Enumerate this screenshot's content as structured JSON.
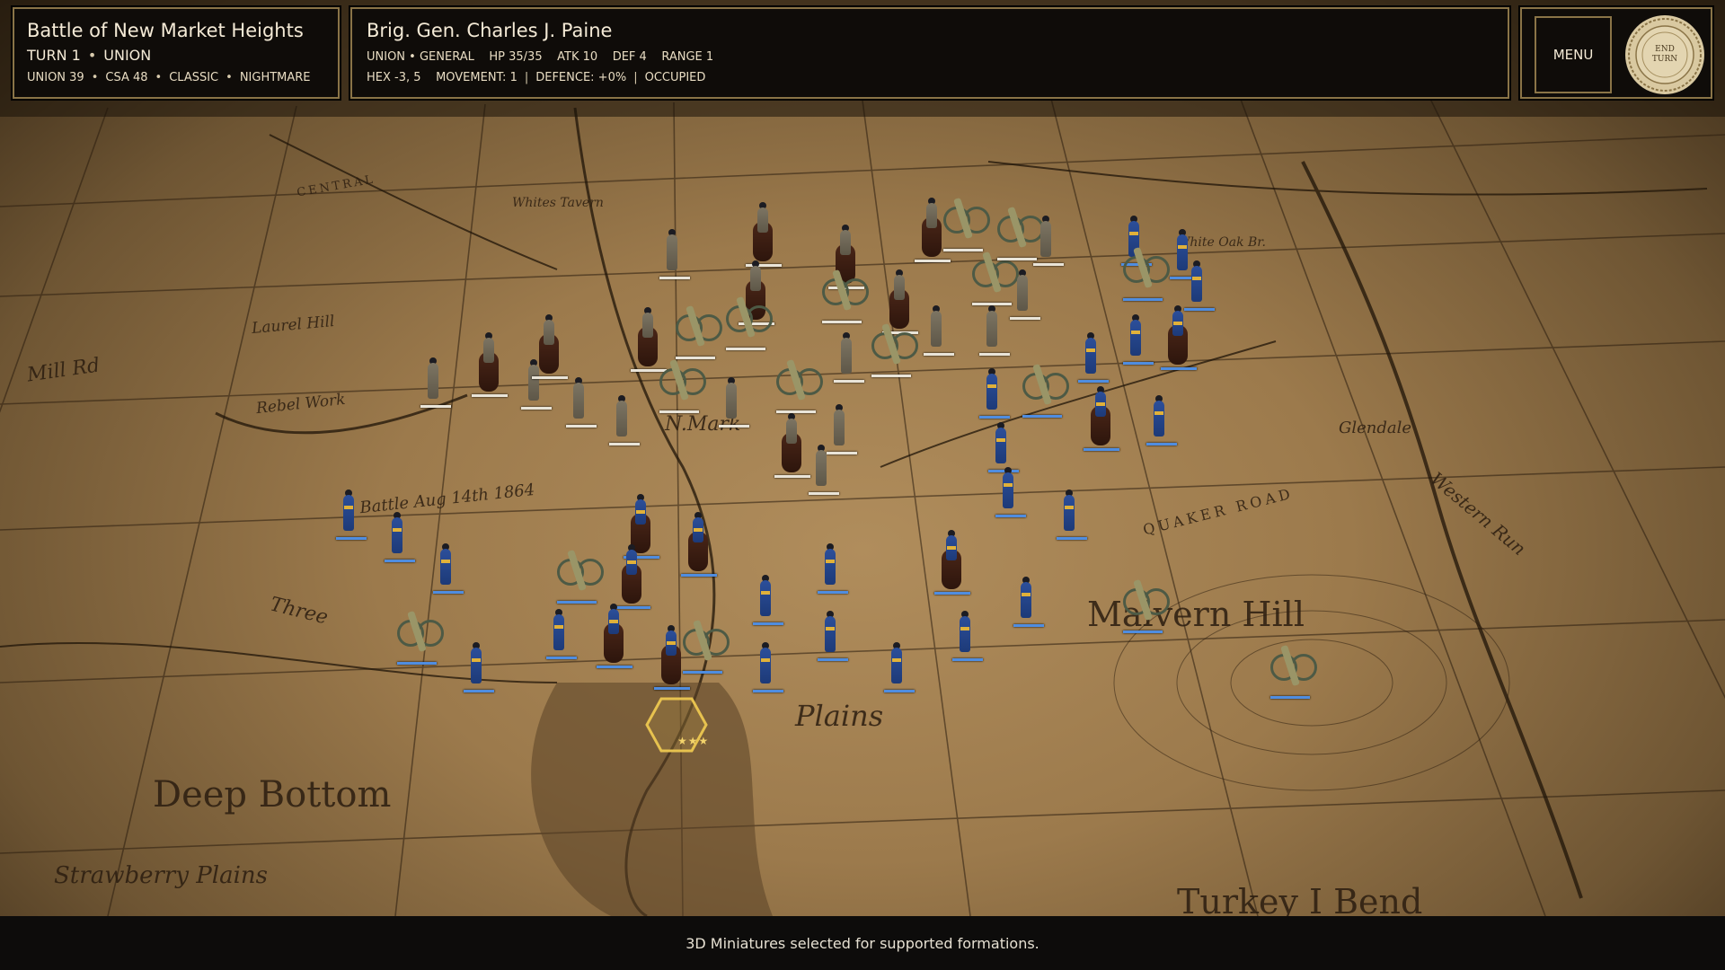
{
  "battle": {
    "title": "Battle of New Market Heights",
    "turn": "TURN 1",
    "side": "UNION",
    "union_score": "UNION 39",
    "csa_score": "CSA 48",
    "mode": "CLASSIC",
    "difficulty": "NIGHTMARE"
  },
  "selected_unit": {
    "name": "Brig. Gen. Charles J. Paine",
    "faction_role": "UNION • GENERAL",
    "hp": "HP 35/35",
    "atk": "ATK 10",
    "def": "DEF 4",
    "range": "RANGE 1",
    "hex": "HEX -3, 5",
    "movement": "MOVEMENT: 1",
    "defence": "DEFENCE: +0%",
    "occupied": "OCCUPIED",
    "rank_stars": "★★★"
  },
  "menu": {
    "menu_label": "MENU",
    "end_turn_label": "END\nTURN"
  },
  "status": {
    "message": "3D Miniatures selected for supported formations."
  },
  "map_labels": {
    "whites_tavern": "Whites Tavern",
    "laurel_hill": "Laurel Hill",
    "mill_rd": "Mill Rd",
    "rebel_work": "Rebel Work",
    "new_market": "N.Mark",
    "battle_note": "Battle Aug 14th 1864",
    "glendale": "Glendale",
    "plains": "Plains",
    "deep_bottom": "Deep Bottom",
    "strawberry_plains": "Strawberry Plains",
    "malvern_hill": "Malvern Hill",
    "turkey_bend": "Turkey I Bend",
    "western_run": "Western Run",
    "quaker_road": "QUAKER ROAD",
    "white_oak": "White Oak Br.",
    "central": "CENTRAL",
    "three_mile": "Three"
  },
  "colors": {
    "panel_border": "#8a7447",
    "union_blue": "#2c4f9a",
    "csa_gray": "#7d7563",
    "hp_bar_union": "#4f8de0",
    "selection_gold": "#e7c24f"
  }
}
